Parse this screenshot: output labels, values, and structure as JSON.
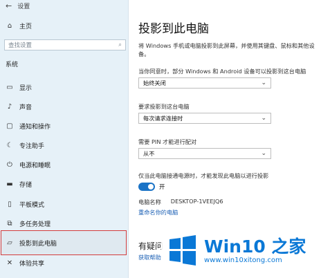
{
  "window": {
    "title": "设置"
  },
  "sidebar": {
    "home": "主页",
    "search_placeholder": "查找设置",
    "section": "系统",
    "items": [
      {
        "label": "显示",
        "icon": "monitor-icon"
      },
      {
        "label": "声音",
        "icon": "speaker-icon"
      },
      {
        "label": "通知和操作",
        "icon": "notification-icon"
      },
      {
        "label": "专注助手",
        "icon": "moon-icon"
      },
      {
        "label": "电源和睡眠",
        "icon": "power-icon"
      },
      {
        "label": "存储",
        "icon": "storage-icon"
      },
      {
        "label": "平板模式",
        "icon": "tablet-icon"
      },
      {
        "label": "多任务处理",
        "icon": "multitask-icon"
      },
      {
        "label": "投影到此电脑",
        "icon": "project-icon",
        "selected": true
      },
      {
        "label": "体验共享",
        "icon": "share-icon"
      }
    ]
  },
  "main": {
    "title": "投影到此电脑",
    "description": "将 Windows 手机或电脑投影到此屏幕，并使用其键盘、鼠标和其他设备。",
    "setting1": {
      "label": "当你同意时，部分 Windows 和 Android 设备可以投影到这台电脑",
      "value": "始终关闭"
    },
    "setting2": {
      "label": "要求投影到这台电脑",
      "value": "每次请求连接时"
    },
    "setting3": {
      "label": "需要 PIN 才能进行配对",
      "value": "从不"
    },
    "setting4": {
      "label": "仅当此电脑接通电源时，才能发现此电脑以进行投影",
      "toggle_state": "开",
      "toggle_on": true
    },
    "pc_name_label": "电脑名称",
    "pc_name_value": "DESKTOP-1VEEJQ6",
    "rename_link": "重命名你的电脑",
    "question": "有疑问",
    "help_link": "获取帮助"
  },
  "watermark": {
    "title": "Win10 之家",
    "url": "www.win10xitong.com"
  }
}
